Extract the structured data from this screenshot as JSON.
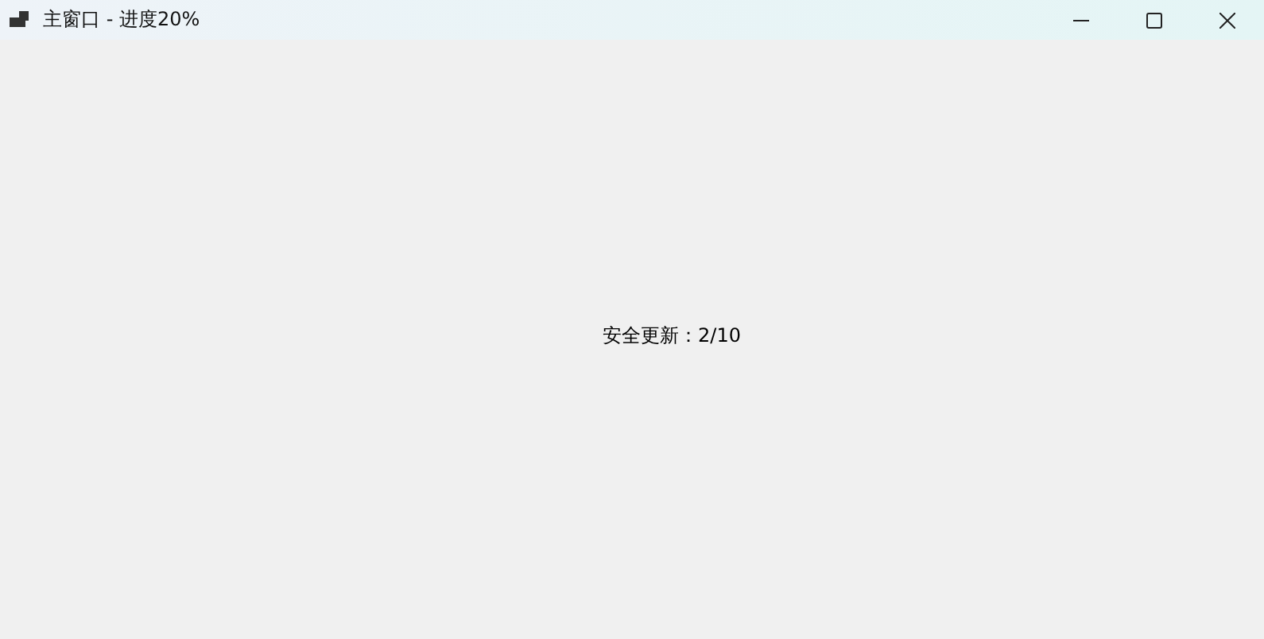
{
  "window": {
    "title": "主窗口 - 进度20%"
  },
  "status_label": "安全更新：2/10"
}
